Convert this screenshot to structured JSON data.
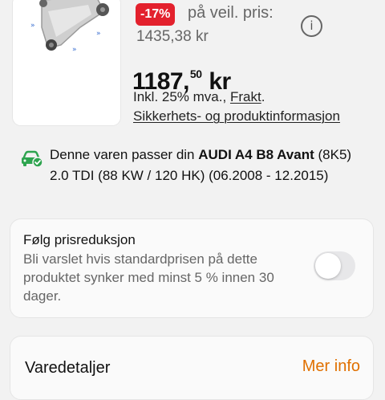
{
  "product": {
    "discount_badge": "-17%",
    "veil_label": "på veil. pris:",
    "veil_price": "1435,38 kr",
    "price_main": "1187,",
    "price_cents": "50",
    "price_currency": "kr",
    "vat_text": "Inkl. 25% mva.,",
    "freight_link": "Frakt",
    "freight_suffix": ".",
    "safety_link": "Sikkerhets- og produktinformasjon"
  },
  "fitment": {
    "prefix": "Denne varen passer din ",
    "vehicle": "AUDI A4 B8 Avant",
    "details": "(8K5) 2.0 TDI (88 KW / 120 HK) (06.2008 - 12.2015)",
    "icon_color": "#2ea44f"
  },
  "price_tracking": {
    "title": "Følg prisreduksjon",
    "description": "Bli varslet hvis standardprisen på dette produktet synker med minst 5 % innen 30 dager.",
    "toggle_on": false
  },
  "details_section": {
    "title": "Varedetaljer",
    "more_link": "Mer info",
    "accent_color": "#e07000"
  },
  "icons": {
    "info": "info-icon",
    "car": "car-check-icon"
  }
}
